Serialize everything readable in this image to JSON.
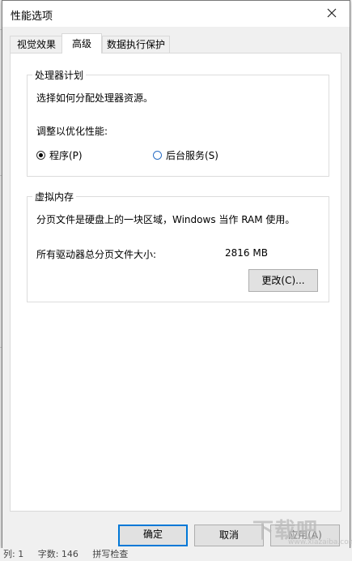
{
  "dialog": {
    "title": "性能选项",
    "tabs": [
      {
        "label": "视觉效果"
      },
      {
        "label": "高级"
      },
      {
        "label": "数据执行保护"
      }
    ],
    "processor": {
      "group_title": "处理器计划",
      "description": "选择如何分配处理器资源。",
      "adjust_label": "调整以优化性能:",
      "option_programs": "程序(P)",
      "option_services": "后台服务(S)",
      "selected": "程序(P)"
    },
    "virtual_memory": {
      "group_title": "虚拟内存",
      "description": "分页文件是硬盘上的一块区域，Windows 当作 RAM 使用。",
      "total_label": "所有驱动器总分页文件大小:",
      "total_value": "2816 MB",
      "change_button": "更改(C)..."
    },
    "buttons": {
      "ok": "确定",
      "cancel": "取消",
      "apply": "应用(A)"
    }
  },
  "background": {
    "status_items": [
      "列: 1",
      "字数: 146",
      "拼写检查"
    ]
  },
  "watermark": {
    "text": "下载吧",
    "sub": "www.xiazaiba.com"
  },
  "colors": {
    "accent": "#0078d7",
    "dialog_bg": "#f0f0f0",
    "panel_bg": "#ffffff"
  }
}
